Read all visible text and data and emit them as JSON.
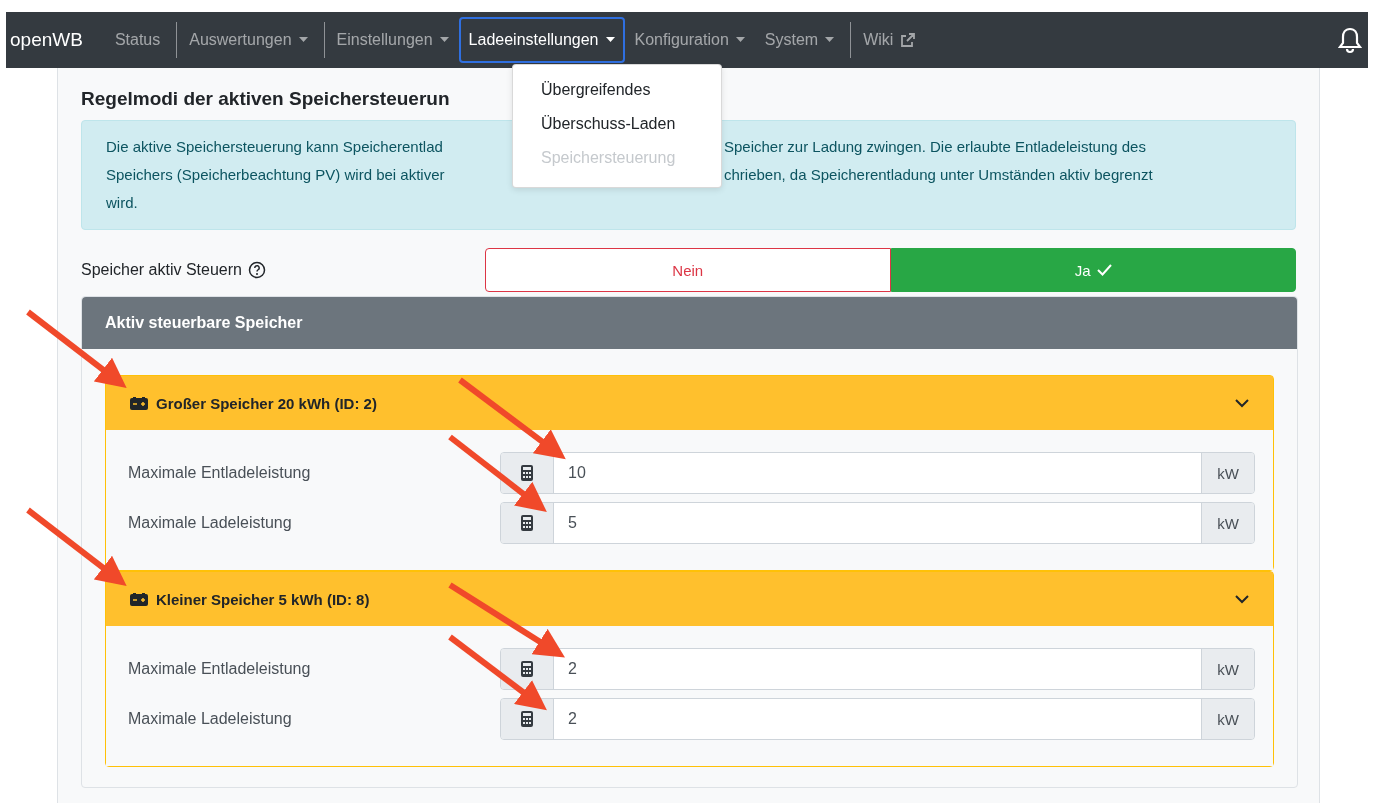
{
  "navbar": {
    "brand": "openWB",
    "items": [
      {
        "label": "Status",
        "selected": false,
        "dropdown": false,
        "external": false,
        "divider_after": true
      },
      {
        "label": "Auswertungen",
        "selected": false,
        "dropdown": true,
        "external": false,
        "divider_after": true
      },
      {
        "label": "Einstellungen",
        "selected": false,
        "dropdown": true,
        "external": false,
        "divider_after": false
      },
      {
        "label": "Ladeeinstellungen",
        "selected": true,
        "dropdown": true,
        "external": false,
        "divider_after": false
      },
      {
        "label": "Konfiguration",
        "selected": false,
        "dropdown": true,
        "external": false,
        "divider_after": false
      },
      {
        "label": "System",
        "selected": false,
        "dropdown": true,
        "external": false,
        "divider_after": true
      },
      {
        "label": "Wiki",
        "selected": false,
        "dropdown": false,
        "external": true,
        "divider_after": false
      }
    ]
  },
  "dropdown_menu": [
    {
      "label": "Übergreifendes",
      "disabled": false
    },
    {
      "label": "Überschuss-Laden",
      "disabled": false
    },
    {
      "label": "Speichersteuerung",
      "disabled": true
    }
  ],
  "title": "Regelmodi der aktiven Speichersteuerun",
  "info_lines": [
    [
      "Die aktive Speichersteuerung kann Speicherentlad",
      "Speicher zur Ladung zwingen. Die erlaubte Entladeleistung des"
    ],
    [
      "Speichers (Speicherbeachtung PV) wird bei aktiver",
      "chrieben, da Speicherentladung unter Umständen aktiv begrenzt"
    ],
    [
      "wird."
    ]
  ],
  "toggle": {
    "label": "Speicher aktiv Steuern",
    "options": [
      {
        "label": "Nein",
        "kind": "no",
        "selected": false
      },
      {
        "label": "Ja",
        "kind": "yes",
        "selected": true
      }
    ]
  },
  "panel": {
    "title": "Aktiv steuerbare Speicher",
    "storages": [
      {
        "title": "Großer Speicher 20 kWh (ID: 2)",
        "expanded": true,
        "fields": [
          {
            "label": "Maximale Entladeleistung",
            "value": "10",
            "unit": "kW"
          },
          {
            "label": "Maximale Ladeleistung",
            "value": "5",
            "unit": "kW"
          }
        ]
      },
      {
        "title": "Kleiner Speicher 5 kWh (ID: 8)",
        "expanded": true,
        "fields": [
          {
            "label": "Maximale Entladeleistung",
            "value": "2",
            "unit": "kW"
          },
          {
            "label": "Maximale Ladeleistung",
            "value": "2",
            "unit": "kW"
          }
        ]
      }
    ]
  }
}
